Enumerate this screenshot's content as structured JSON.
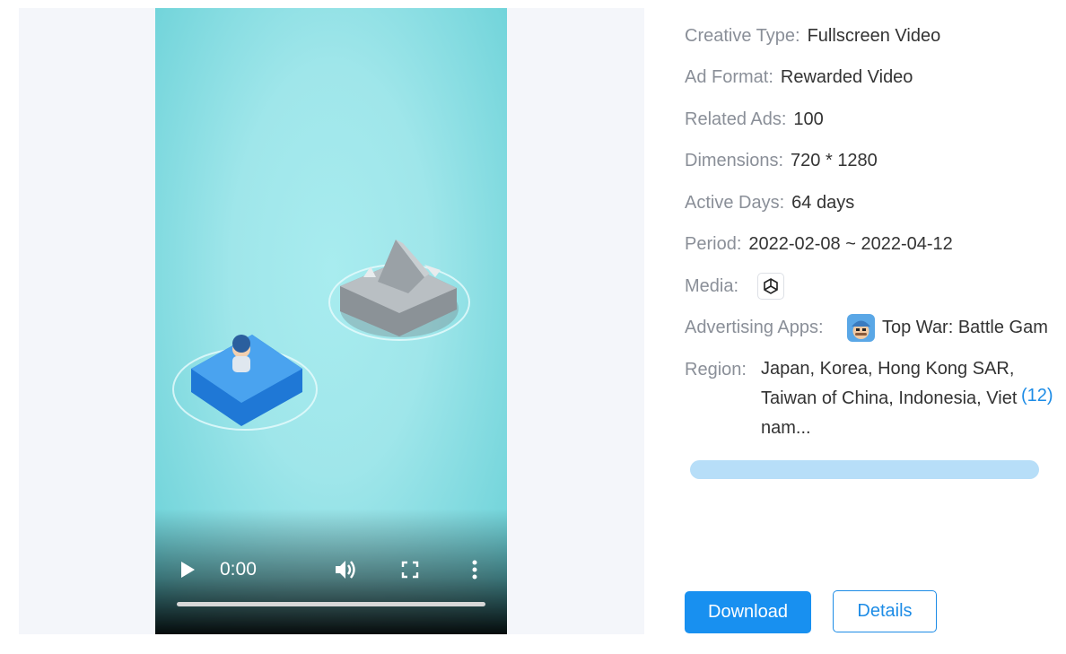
{
  "player": {
    "time": "0:00",
    "play_icon": "play-icon",
    "volume_icon": "volume-icon",
    "fullscreen_icon": "fullscreen-icon",
    "more_icon": "more-vertical-icon"
  },
  "details": {
    "creative_type": {
      "label": "Creative Type:",
      "value": "Fullscreen Video"
    },
    "ad_format": {
      "label": "Ad Format:",
      "value": "Rewarded Video"
    },
    "related_ads": {
      "label": "Related Ads:",
      "value": "100"
    },
    "dimensions": {
      "label": "Dimensions:",
      "value": "720 * 1280"
    },
    "active_days": {
      "label": "Active Days:",
      "value": "64 days"
    },
    "period": {
      "label": "Period:",
      "value": "2022-02-08 ~ 2022-04-12"
    },
    "media": {
      "label": "Media:",
      "icon": "unity-icon"
    },
    "advertising_apps": {
      "label": "Advertising Apps:",
      "app_name": "Top War: Battle Gam"
    },
    "region": {
      "label": "Region:",
      "value": "Japan, Korea, Hong Kong SAR, Taiwan of China, Indonesia, Vietnam...",
      "count": "(12)"
    }
  },
  "actions": {
    "download": "Download",
    "details": "Details"
  },
  "colors": {
    "accent": "#1890f0",
    "link": "#1d8ce6",
    "progress": "#b7def8"
  }
}
